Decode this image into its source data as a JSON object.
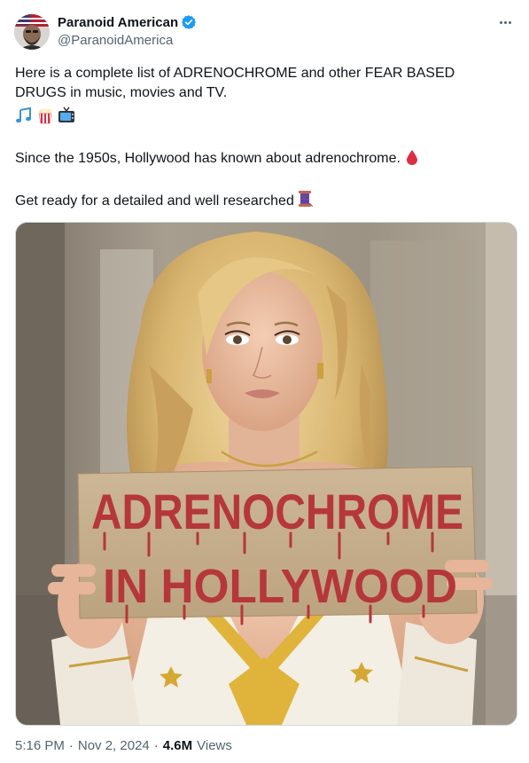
{
  "author": {
    "display_name": "Paranoid American",
    "handle": "@ParanoidAmerica"
  },
  "tweet": {
    "line1": "Here is a complete list of ADRENOCHROME and other FEAR BASED",
    "line2": "DRUGS in music, movies and TV.",
    "line3": "Since the 1950s, Hollywood has known about adrenochrome.",
    "line4": "Get ready for a detailed and well researched"
  },
  "emojis": [
    "musical-notes",
    "popcorn",
    "television",
    "blood-drop",
    "thread-spool"
  ],
  "media": {
    "sign_line1": "ADRENOCHROME",
    "sign_line2": "IN HOLLYWOOD"
  },
  "footer": {
    "time": "5:16 PM",
    "separator1": "·",
    "date": "Nov 2, 2024",
    "separator2": "·",
    "views_count": "4.6M",
    "views_label": "Views"
  },
  "colors": {
    "verified_blue": "#1d9bf0",
    "text_primary": "#0f1419",
    "text_secondary": "#536471",
    "sign_paint": "#b5373a"
  }
}
